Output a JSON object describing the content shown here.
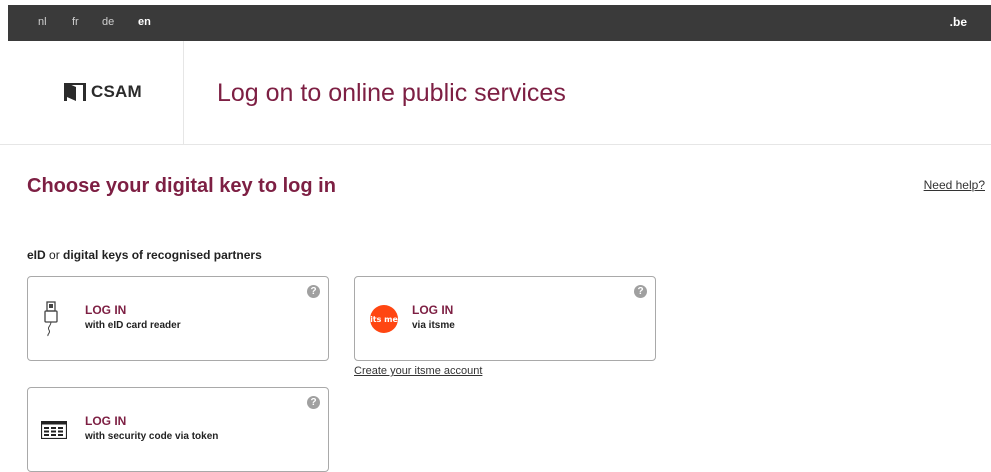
{
  "topbar": {
    "languages": [
      "nl",
      "fr",
      "de",
      "en"
    ],
    "active_language": "en",
    "domain_badge": ".be"
  },
  "header": {
    "logo_text": "CSAM",
    "title": "Log on to online public services"
  },
  "main": {
    "section_title": "Choose your digital key to log in",
    "help_link": "Need help?",
    "subtitle_part1": "eID",
    "subtitle_or": " or ",
    "subtitle_part2": "digital keys of recognised partners",
    "cards": [
      {
        "title": "LOG IN",
        "subtitle": "with eID card reader"
      },
      {
        "title": "LOG IN",
        "subtitle": "via itsme"
      },
      {
        "title": "LOG IN",
        "subtitle": "with security code via token"
      }
    ],
    "create_itsme_link": "Create your itsme account",
    "itsme_logo_text": "its me"
  },
  "colors": {
    "accent": "#7d1f43",
    "topbar": "#3a3a3a",
    "itsme": "#ff4612"
  }
}
